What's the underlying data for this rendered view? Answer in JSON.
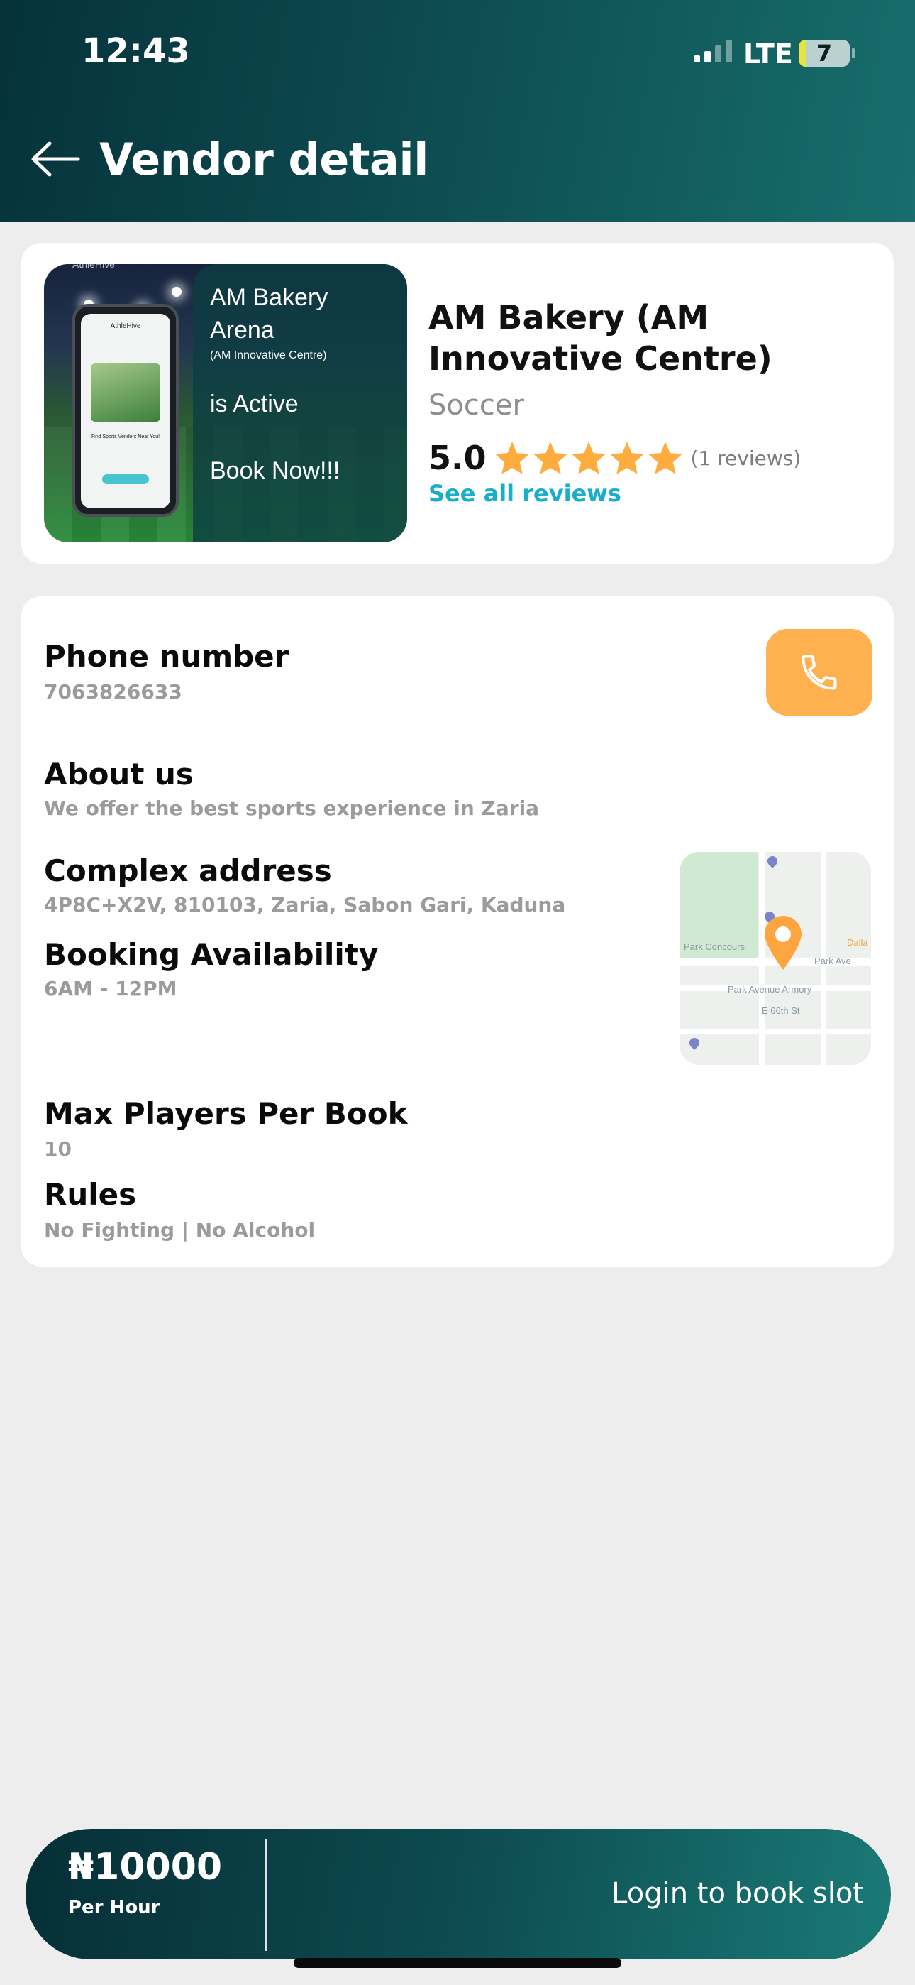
{
  "status_bar": {
    "time": "12:43",
    "network": "LTE",
    "battery": "7"
  },
  "header": {
    "title": "Vendor detail",
    "back_icon": "arrow-left-icon"
  },
  "vendor": {
    "promo": {
      "brand": "AthleHive",
      "title": "AM Bakery Arena",
      "subtitle": "(AM Innovative Centre)",
      "status": "is Active",
      "cta": "Book Now!!!",
      "app_name": "AthleHive",
      "tagline": "Find Sports Vendors Near You!"
    },
    "name": "AM Bakery (AM Innovative Centre)",
    "sport": "Soccer",
    "rating": "5.0",
    "stars": 5,
    "reviews_count": "(1 reviews)",
    "see_all_reviews": "See all reviews"
  },
  "details": {
    "phone_label": "Phone number",
    "phone_value": "7063826633",
    "about_label": "About us",
    "about_value": "We offer the best sports experience in Zaria",
    "address_label": "Complex address",
    "address_value": "4P8C+X2V, 810103, Zaria, Sabon Gari, Kaduna",
    "availability_label": "Booking Availability",
    "availability_value": "6AM - 12PM",
    "max_players_label": "Max Players Per Book",
    "max_players_value": "10",
    "rules_label": "Rules",
    "rules_value": "No Fighting | No Alcohol",
    "call_icon": "phone-icon",
    "map": {
      "labels": [
        "Park Concours",
        "Park Avenue Armory",
        "Park Ave",
        "E 66th St",
        "Dalla"
      ]
    }
  },
  "booking_bar": {
    "price": "₦10000",
    "unit": "Per Hour",
    "action": "Login to book slot"
  },
  "colors": {
    "header_dark": "#06323a",
    "header_light": "#176e6c",
    "accent_orange": "#ffb14f",
    "star": "#ffac3e",
    "link": "#1aaecb",
    "muted_text": "#9b9b9b"
  }
}
